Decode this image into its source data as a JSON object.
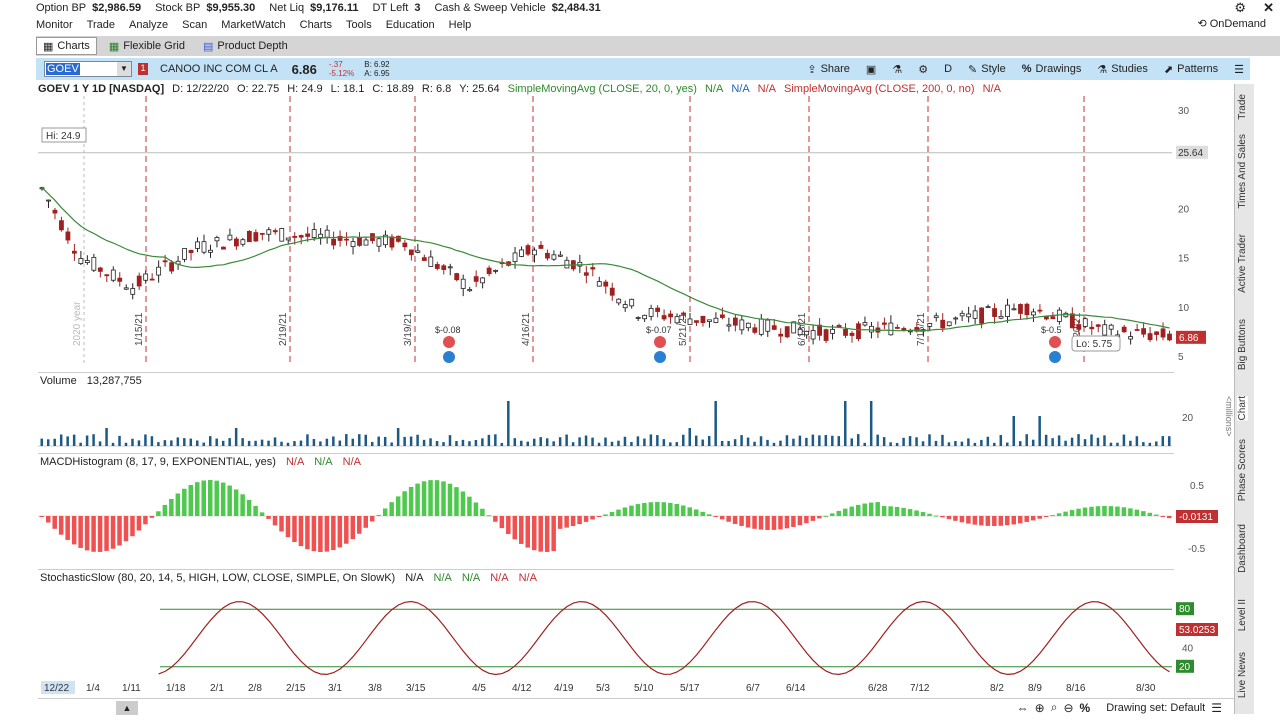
{
  "account": {
    "items": [
      {
        "label": "Option BP",
        "value": "$2,986.59"
      },
      {
        "label": "Stock BP",
        "value": "$9,955.30"
      },
      {
        "label": "Net Liq",
        "value": "$9,176.11"
      },
      {
        "label": "DT Left",
        "value": "3"
      },
      {
        "label": "Cash & Sweep Vehicle",
        "value": "$2,484.31"
      }
    ]
  },
  "menu": [
    "Monitor",
    "Trade",
    "Analyze",
    "Scan",
    "MarketWatch",
    "Charts",
    "Tools",
    "Education",
    "Help"
  ],
  "ondemand_label": "OnDemand",
  "subtabs": [
    "Charts",
    "Flexible Grid",
    "Product Depth"
  ],
  "toolbar": {
    "symbol": "GOEV",
    "company": "CANOO INC COM CL A",
    "last": "6.86",
    "change": "-.37",
    "change_pct": "-5.12%",
    "bid": "B: 6.92",
    "ask": "A: 6.95",
    "share": "Share",
    "timeframe": "D",
    "style": "Style",
    "drawings": "Drawings",
    "studies": "Studies",
    "patterns": "Patterns"
  },
  "chartinfo": {
    "title": "GOEV 1 Y 1D [NASDAQ]",
    "d": "D: 12/22/20",
    "o": "O: 22.75",
    "h": "H: 24.9",
    "l": "L: 18.1",
    "c": "C: 18.89",
    "r": "R: 6.8",
    "y": "Y: 25.64",
    "sma20": "SimpleMovingAvg (CLOSE, 20, 0, yes)",
    "na": "N/A",
    "sma200": "SimpleMovingAvg (CLOSE, 200, 0, no)"
  },
  "price_chart": {
    "y_ticks": [
      "30",
      "25.64",
      "20",
      "15",
      "10",
      "5"
    ],
    "current_price": "6.86",
    "hi_label": "Hi: 24.9",
    "lo_label": "Lo: 5.75",
    "year_label": "2020 year",
    "month_labels": [
      "1/15/21",
      "2/19/21",
      "3/19/21",
      "4/16/21",
      "5/21/21",
      "6/18/21",
      "7/16/21",
      "8/20/21"
    ],
    "earnings": [
      "$-0.08",
      "$-0.07",
      "$-0.5"
    ]
  },
  "volume": {
    "label": "Volume",
    "value": "13,287,755",
    "axis": "20",
    "unit": "<millions>"
  },
  "macd": {
    "label": "MACDHistogram (8, 17, 9, EXPONENTIAL, yes)",
    "na": "N/A",
    "ticks": [
      "0.5",
      "-0.5"
    ],
    "current": "-0.0131"
  },
  "stoch": {
    "label": "StochasticSlow (80, 20, 14, 5, HIGH, LOW, CLOSE, SIMPLE, On SlowK)",
    "na": "N/A",
    "ticks": [
      "80",
      "40",
      "20"
    ],
    "current": "53.0253"
  },
  "x_axis": [
    "12/22",
    "1/4",
    "1/11",
    "1/18",
    "2/1",
    "2/8",
    "2/15",
    "3/1",
    "3/8",
    "3/15",
    "4/5",
    "4/12",
    "4/19",
    "5/3",
    "5/10",
    "5/17",
    "6/7",
    "6/14",
    "6/28",
    "7/12",
    "8/2",
    "8/9",
    "8/16",
    "8/30"
  ],
  "right_tabs": [
    "Trade",
    "Times And Sales",
    "Active Trader",
    "Big Buttons",
    "Chart",
    "Phase Scores",
    "Dashboard",
    "Level II",
    "Live News"
  ],
  "drawing_set": "Drawing set: Default",
  "colors": {
    "toolbar_bg": "#c3e2f5",
    "up": "#2e8b2e",
    "down": "#a02020",
    "sma": "#3a8a3a",
    "macd_pos": "#4ec94e",
    "macd_neg": "#f05050"
  }
}
